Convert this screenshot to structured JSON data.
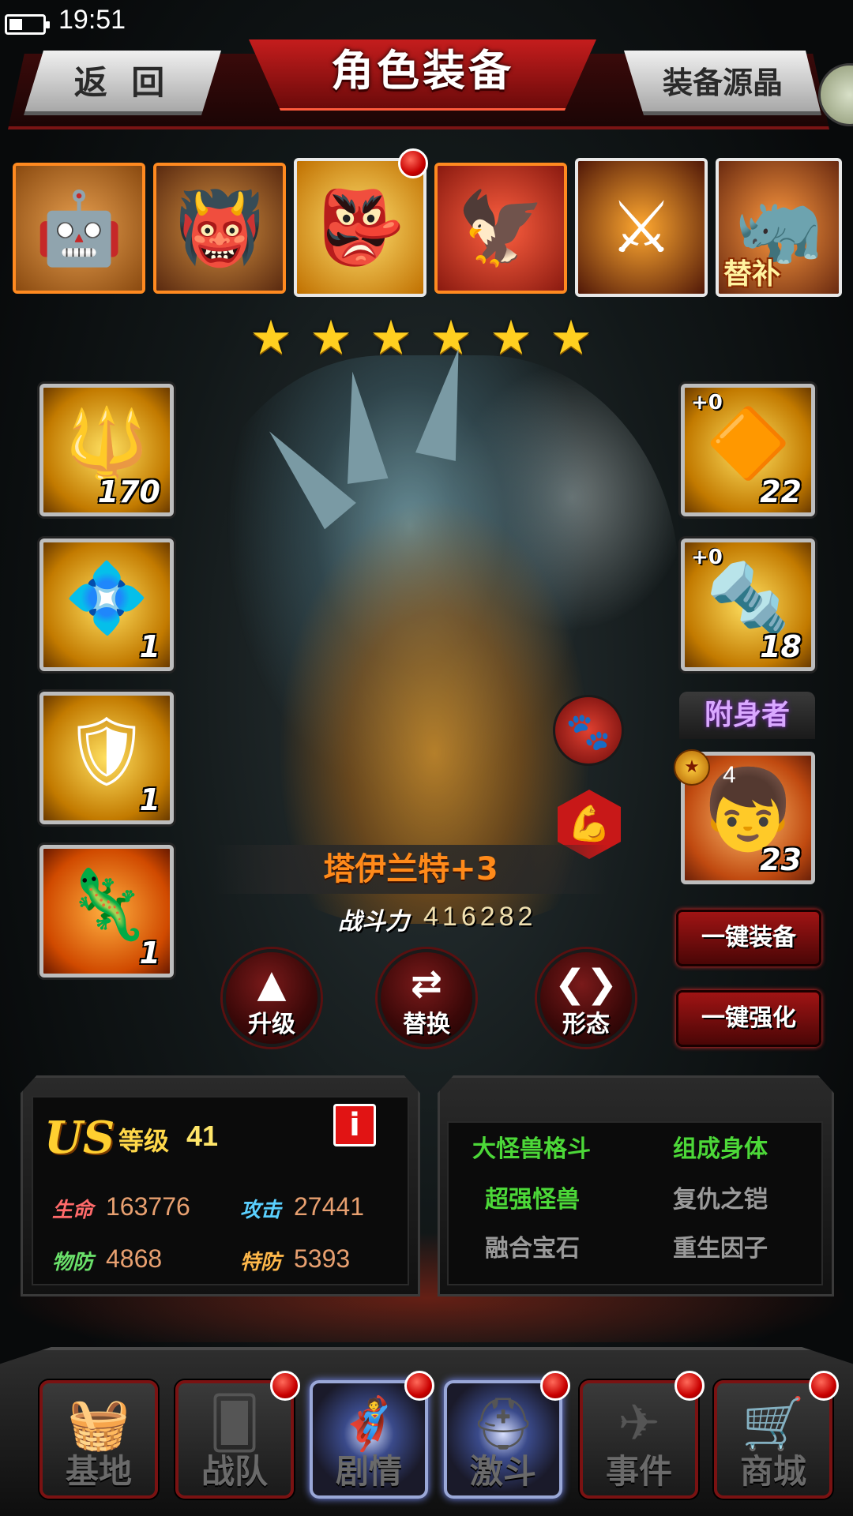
{
  "status_bar": {
    "time": "19:51"
  },
  "header": {
    "title": "角色装备",
    "back_label": "返 回",
    "crystal_label": "装备源晶"
  },
  "roster": {
    "substitute_tag": "替补",
    "members": [
      {
        "icon": "robot-monster"
      },
      {
        "icon": "gold-demon-monster"
      },
      {
        "icon": "golden-monster",
        "selected": true
      },
      {
        "icon": "bird-monster"
      },
      {
        "icon": "armored-knight-monster"
      },
      {
        "icon": "horned-monster",
        "substitute": true
      }
    ]
  },
  "stars": 6,
  "equipment_left": [
    {
      "icon": "blue-mace-icon",
      "count": "170"
    },
    {
      "icon": "blue-crystal-ring-icon",
      "count": "1"
    },
    {
      "icon": "gold-armor-icon",
      "count": "1"
    },
    {
      "icon": "blue-claw-icon",
      "count": "1"
    }
  ],
  "equipment_right": [
    {
      "icon": "gold-shard-icon",
      "plus": "+0",
      "count": "22"
    },
    {
      "icon": "drill-gauntlet-icon",
      "plus": "+0",
      "count": "18"
    }
  ],
  "possessor": {
    "label": "附身者",
    "level": "4",
    "count": "23"
  },
  "character": {
    "name": "塔伊兰特+3",
    "power_label": "战斗力",
    "power_value": "416282"
  },
  "actions": {
    "upgrade": "升级",
    "replace": "替换",
    "form": "形态"
  },
  "quick": {
    "equip_all": "一键装备",
    "strengthen_all": "一键强化"
  },
  "stats": {
    "rank": "US",
    "level_label": "等级",
    "level": "41",
    "hp_label": "生命",
    "hp": "163776",
    "atk_label": "攻击",
    "atk": "27441",
    "pdef_label": "物防",
    "pdef": "4868",
    "sdef_label": "特防",
    "sdef": "5393"
  },
  "skills": [
    {
      "name": "大怪兽格斗",
      "active": true
    },
    {
      "name": "组成身体",
      "active": true
    },
    {
      "name": "超强怪兽",
      "active": true
    },
    {
      "name": "复仇之铠",
      "active": false
    },
    {
      "name": "融合宝石",
      "active": false
    },
    {
      "name": "重生因子",
      "active": false
    }
  ],
  "nav": [
    {
      "label": "基地",
      "icon": "basket-icon",
      "lit": false
    },
    {
      "label": "战队",
      "icon": "cards-icon",
      "lit": false
    },
    {
      "label": "剧情",
      "icon": "hero-icon",
      "lit": true
    },
    {
      "label": "激斗",
      "icon": "helmet-icon",
      "lit": true
    },
    {
      "label": "事件",
      "icon": "plane-icon",
      "lit": false
    },
    {
      "label": "商城",
      "icon": "cart-icon",
      "lit": false
    }
  ],
  "colors": {
    "accent_red": "#c81818",
    "skill_active": "#4cd838",
    "skill_inactive": "#9a9a9a",
    "stat_value": "#e8a070"
  }
}
